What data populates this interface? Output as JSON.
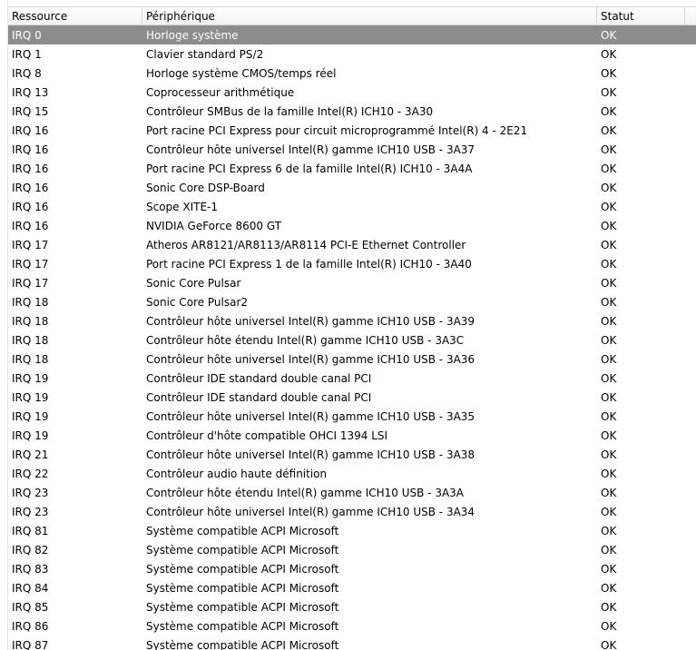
{
  "columns": [
    "Ressource",
    "Périphérique",
    "Statut"
  ],
  "rows": [
    {
      "resource": "IRQ 0",
      "device": "Horloge système",
      "status": "OK",
      "selected": true
    },
    {
      "resource": "IRQ 1",
      "device": "Clavier standard PS/2",
      "status": "OK"
    },
    {
      "resource": "IRQ 8",
      "device": "Horloge système CMOS/temps réel",
      "status": "OK"
    },
    {
      "resource": "IRQ 13",
      "device": "Coprocesseur arithmétique",
      "status": "OK"
    },
    {
      "resource": "IRQ 15",
      "device": "Contrôleur SMBus de la famille Intel(R) ICH10 - 3A30",
      "status": "OK"
    },
    {
      "resource": "IRQ 16",
      "device": "Port racine PCI Express pour circuit microprogrammé Intel(R) 4 - 2E21",
      "status": "OK"
    },
    {
      "resource": "IRQ 16",
      "device": "Contrôleur hôte universel Intel(R) gamme ICH10 USB - 3A37",
      "status": "OK"
    },
    {
      "resource": "IRQ 16",
      "device": "Port racine PCI Express 6 de la famille Intel(R) ICH10 - 3A4A",
      "status": "OK"
    },
    {
      "resource": "IRQ 16",
      "device": "Sonic Core DSP-Board",
      "status": "OK"
    },
    {
      "resource": "IRQ 16",
      "device": "Scope XITE-1",
      "status": "OK"
    },
    {
      "resource": "IRQ 16",
      "device": "NVIDIA GeForce 8600 GT",
      "status": "OK"
    },
    {
      "resource": "IRQ 17",
      "device": "Atheros AR8121/AR8113/AR8114 PCI-E Ethernet Controller",
      "status": "OK"
    },
    {
      "resource": "IRQ 17",
      "device": "Port racine PCI Express 1 de la famille Intel(R) ICH10 - 3A40",
      "status": "OK"
    },
    {
      "resource": "IRQ 17",
      "device": "Sonic Core Pulsar",
      "status": "OK"
    },
    {
      "resource": "IRQ 18",
      "device": "Sonic Core Pulsar2",
      "status": "OK"
    },
    {
      "resource": "IRQ 18",
      "device": "Contrôleur hôte universel Intel(R) gamme ICH10 USB - 3A39",
      "status": "OK"
    },
    {
      "resource": "IRQ 18",
      "device": "Contrôleur hôte étendu Intel(R) gamme ICH10 USB - 3A3C",
      "status": "OK"
    },
    {
      "resource": "IRQ 18",
      "device": "Contrôleur hôte universel Intel(R) gamme ICH10 USB - 3A36",
      "status": "OK"
    },
    {
      "resource": "IRQ 19",
      "device": "Contrôleur IDE standard double canal PCI",
      "status": "OK"
    },
    {
      "resource": "IRQ 19",
      "device": "Contrôleur IDE standard double canal PCI",
      "status": "OK"
    },
    {
      "resource": "IRQ 19",
      "device": "Contrôleur hôte universel Intel(R) gamme ICH10 USB - 3A35",
      "status": "OK"
    },
    {
      "resource": "IRQ 19",
      "device": "Contrôleur d'hôte compatible OHCI 1394 LSI",
      "status": "OK"
    },
    {
      "resource": "IRQ 21",
      "device": "Contrôleur hôte universel Intel(R) gamme ICH10 USB - 3A38",
      "status": "OK"
    },
    {
      "resource": "IRQ 22",
      "device": "Contrôleur audio haute définition",
      "status": "OK"
    },
    {
      "resource": "IRQ 23",
      "device": "Contrôleur hôte étendu Intel(R) gamme ICH10 USB - 3A3A",
      "status": "OK"
    },
    {
      "resource": "IRQ 23",
      "device": "Contrôleur hôte universel Intel(R) gamme ICH10 USB - 3A34",
      "status": "OK"
    },
    {
      "resource": "IRQ 81",
      "device": "Système compatible ACPI Microsoft",
      "status": "OK"
    },
    {
      "resource": "IRQ 82",
      "device": "Système compatible ACPI Microsoft",
      "status": "OK"
    },
    {
      "resource": "IRQ 83",
      "device": "Système compatible ACPI Microsoft",
      "status": "OK"
    },
    {
      "resource": "IRQ 84",
      "device": "Système compatible ACPI Microsoft",
      "status": "OK"
    },
    {
      "resource": "IRQ 85",
      "device": "Système compatible ACPI Microsoft",
      "status": "OK"
    },
    {
      "resource": "IRQ 86",
      "device": "Système compatible ACPI Microsoft",
      "status": "OK"
    },
    {
      "resource": "IRQ 87",
      "device": "Système compatible ACPI Microsoft",
      "status": "OK"
    }
  ]
}
